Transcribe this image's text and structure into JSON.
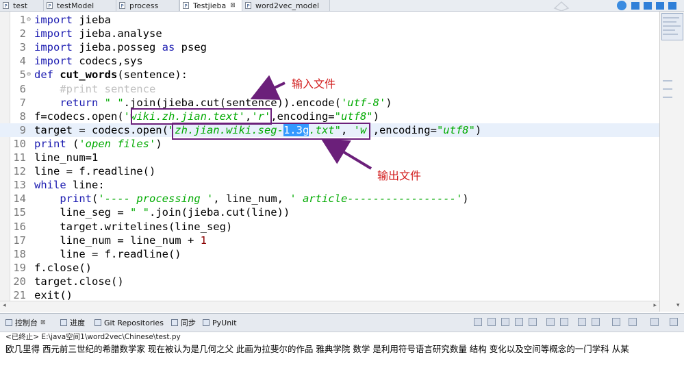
{
  "tabs": [
    {
      "label": "test",
      "icon": "file-icon",
      "active": false
    },
    {
      "label": "testModel",
      "icon": "file-icon",
      "active": false
    },
    {
      "label": "process",
      "icon": "file-icon",
      "active": false
    },
    {
      "label": "Testjieba",
      "icon": "file-icon",
      "active": true,
      "close": "⊠"
    },
    {
      "label": "word2vec_model",
      "icon": "file-icon",
      "active": false
    }
  ],
  "editor": {
    "lines": [
      {
        "n": "1",
        "parts": [
          {
            "t": "import",
            "c": "kw"
          },
          {
            "t": " jieba"
          }
        ]
      },
      {
        "n": "2",
        "parts": [
          {
            "t": "import",
            "c": "kw"
          },
          {
            "t": " jieba.analyse"
          }
        ]
      },
      {
        "n": "3",
        "parts": [
          {
            "t": "import",
            "c": "kw"
          },
          {
            "t": " jieba.posseg "
          },
          {
            "t": "as",
            "c": "kw"
          },
          {
            "t": " pseg"
          }
        ]
      },
      {
        "n": "4",
        "parts": [
          {
            "t": "import",
            "c": "kw"
          },
          {
            "t": " codecs,sys"
          }
        ]
      },
      {
        "n": "5",
        "parts": [
          {
            "t": "def",
            "c": "kw"
          },
          {
            "t": " "
          },
          {
            "t": "cut_words",
            "c": "def"
          },
          {
            "t": "(sentence):"
          }
        ]
      },
      {
        "n": "6",
        "parts": [
          {
            "t": "    "
          },
          {
            "t": "#print sentence",
            "c": "cmt"
          }
        ]
      },
      {
        "n": "7",
        "parts": [
          {
            "t": "    "
          },
          {
            "t": "return",
            "c": "kw"
          },
          {
            "t": " "
          },
          {
            "t": "\" \"",
            "c": "str"
          },
          {
            "t": ".join(jieba.cut(sentence)).encode("
          },
          {
            "t": "'utf-8'",
            "c": "str"
          },
          {
            "t": ")"
          }
        ]
      },
      {
        "n": "8",
        "parts": [
          {
            "t": "f=codecs.open("
          },
          {
            "t": "'wiki.zh.jian.text'",
            "c": "str"
          },
          {
            "t": ","
          },
          {
            "t": "'r'",
            "c": "str"
          },
          {
            "t": ",encoding="
          },
          {
            "t": "\"utf8\"",
            "c": "str"
          },
          {
            "t": ")"
          }
        ]
      },
      {
        "n": "9",
        "parts": [
          {
            "t": "target = codecs.open("
          },
          {
            "t": "\"zh.jian.wiki.seg-",
            "c": "str"
          },
          {
            "t": "1.3g",
            "c": "sel"
          },
          {
            "t": ".txt\"",
            "c": "str"
          },
          {
            "t": ", "
          },
          {
            "t": "'w'",
            "c": "str"
          },
          {
            "t": ",encoding="
          },
          {
            "t": "\"utf8\"",
            "c": "str"
          },
          {
            "t": ")"
          }
        ]
      },
      {
        "n": "10",
        "parts": [
          {
            "t": "print",
            "c": "kw"
          },
          {
            "t": " ("
          },
          {
            "t": "'open files'",
            "c": "str"
          },
          {
            "t": ")"
          }
        ]
      },
      {
        "n": "11",
        "parts": [
          {
            "t": "line_num=1"
          }
        ]
      },
      {
        "n": "12",
        "parts": [
          {
            "t": "line = f.readline()"
          }
        ]
      },
      {
        "n": "13",
        "parts": [
          {
            "t": "while",
            "c": "kw"
          },
          {
            "t": " line:"
          }
        ]
      },
      {
        "n": "14",
        "parts": [
          {
            "t": "    "
          },
          {
            "t": "print",
            "c": "kw"
          },
          {
            "t": "("
          },
          {
            "t": "'---- processing '",
            "c": "str"
          },
          {
            "t": ", line_num, "
          },
          {
            "t": "' article-----------------'",
            "c": "str"
          },
          {
            "t": ")"
          }
        ]
      },
      {
        "n": "15",
        "parts": [
          {
            "t": "    line_seg = "
          },
          {
            "t": "\" \"",
            "c": "str"
          },
          {
            "t": ".join(jieba.cut(line))"
          }
        ]
      },
      {
        "n": "16",
        "parts": [
          {
            "t": "    target.writelines(line_seg)"
          }
        ]
      },
      {
        "n": "17",
        "parts": [
          {
            "t": "    line_num = line_num + "
          },
          {
            "t": "1",
            "c": "num"
          }
        ]
      },
      {
        "n": "18",
        "parts": [
          {
            "t": "    line = f.readline()"
          }
        ]
      },
      {
        "n": "19",
        "parts": [
          {
            "t": "f.close()"
          }
        ]
      },
      {
        "n": "20",
        "parts": [
          {
            "t": "target.close()"
          }
        ]
      },
      {
        "n": "21",
        "parts": [
          {
            "t": "exit()"
          }
        ]
      }
    ]
  },
  "annotations": {
    "input_label": "输入文件",
    "output_label": "输出文件"
  },
  "console": {
    "tabs": [
      {
        "label": "控制台",
        "icon": "console-icon",
        "close": "⊠"
      },
      {
        "label": "进度",
        "icon": "progress-icon"
      },
      {
        "label": "Git Repositories",
        "icon": "git-icon"
      },
      {
        "label": "同步",
        "icon": "sync-icon"
      },
      {
        "label": "PyUnit",
        "icon": "pyunit-icon"
      }
    ],
    "status": "<已终止> E:\\java空间1\\word2vec\\Chinese\\test.py",
    "output": "欧几里得 西元前三世纪的希腊数学家 现在被认为是几何之父 此画为拉斐尔的作品 雅典学院 数学 是利用符号语言研究数量 结构 变化以及空间等概念的一门学科 从某"
  },
  "colors": {
    "keyword": "#1a1ab0",
    "string": "#00aa00",
    "annotation_box": "#6b1f7a",
    "annotation_text": "#d21d1d",
    "selection": "#3399ff"
  }
}
